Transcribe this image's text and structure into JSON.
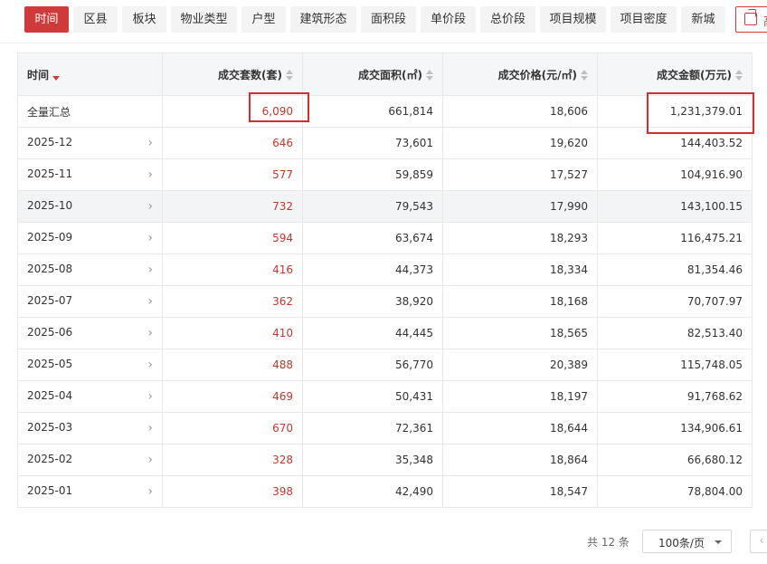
{
  "tabs": [
    {
      "label": "时间",
      "active": true
    },
    {
      "label": "区县"
    },
    {
      "label": "板块"
    },
    {
      "label": "物业类型"
    },
    {
      "label": "户型"
    },
    {
      "label": "建筑形态"
    },
    {
      "label": "面积段"
    },
    {
      "label": "单价段"
    },
    {
      "label": "总价段"
    },
    {
      "label": "项目规模"
    },
    {
      "label": "项目密度"
    },
    {
      "label": "新城"
    }
  ],
  "tool_button": {
    "label": "高",
    "icon": "copy-icon"
  },
  "table": {
    "headers": [
      "时间",
      "成交套数(套)",
      "成交面积(㎡)",
      "成交价格(元/㎡)",
      "成交金额(万元)"
    ],
    "summary": {
      "label": "全量汇总",
      "units": "6,090",
      "area": "661,814",
      "price": "18,606",
      "amount": "1,231,379.01"
    },
    "rows": [
      {
        "month": "2025-12",
        "units": "646",
        "area": "73,601",
        "price": "19,620",
        "amount": "144,403.52"
      },
      {
        "month": "2025-11",
        "units": "577",
        "area": "59,859",
        "price": "17,527",
        "amount": "104,916.90"
      },
      {
        "month": "2025-10",
        "units": "732",
        "area": "79,543",
        "price": "17,990",
        "amount": "143,100.15"
      },
      {
        "month": "2025-09",
        "units": "594",
        "area": "63,674",
        "price": "18,293",
        "amount": "116,475.21"
      },
      {
        "month": "2025-08",
        "units": "416",
        "area": "44,373",
        "price": "18,334",
        "amount": "81,354.46"
      },
      {
        "month": "2025-07",
        "units": "362",
        "area": "38,920",
        "price": "18,168",
        "amount": "70,707.97"
      },
      {
        "month": "2025-06",
        "units": "410",
        "area": "44,445",
        "price": "18,565",
        "amount": "82,513.40"
      },
      {
        "month": "2025-05",
        "units": "488",
        "area": "56,770",
        "price": "20,389",
        "amount": "115,748.05"
      },
      {
        "month": "2025-04",
        "units": "469",
        "area": "50,431",
        "price": "18,197",
        "amount": "91,768.62"
      },
      {
        "month": "2025-03",
        "units": "670",
        "area": "72,361",
        "price": "18,644",
        "amount": "134,906.61"
      },
      {
        "month": "2025-02",
        "units": "328",
        "area": "35,348",
        "price": "18,864",
        "amount": "66,680.12"
      },
      {
        "month": "2025-01",
        "units": "398",
        "area": "42,490",
        "price": "18,547",
        "amount": "78,804.00"
      }
    ]
  },
  "pagination": {
    "total_text": "共 12 条",
    "page_size": "100条/页"
  },
  "colors": {
    "accent": "#d03a3a",
    "highlight_box": "#d32f2f",
    "value_red": "#c0392b"
  }
}
